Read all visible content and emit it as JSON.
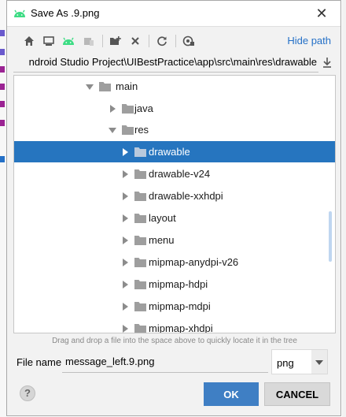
{
  "window": {
    "title": "Save As .9.png",
    "close_glyph": "✕"
  },
  "toolbar": {
    "buttons": [
      {
        "name": "home-icon"
      },
      {
        "name": "desktop-icon"
      },
      {
        "name": "android-icon"
      },
      {
        "name": "module-icon"
      },
      {
        "name": "new-folder-icon"
      },
      {
        "name": "delete-icon"
      },
      {
        "name": "refresh-icon"
      },
      {
        "name": "show-hidden-icon"
      }
    ],
    "hide_path_label": "Hide path"
  },
  "path": {
    "value": "ndroid Studio Project\\UIBestPractice\\app\\src\\main\\res\\drawable"
  },
  "tree": {
    "rows": [
      {
        "label": "main",
        "expanded": true,
        "selected": false
      },
      {
        "label": "java",
        "expanded": false,
        "selected": false
      },
      {
        "label": "res",
        "expanded": true,
        "selected": false
      },
      {
        "label": "drawable",
        "expanded": false,
        "selected": true
      },
      {
        "label": "drawable-v24",
        "expanded": false,
        "selected": false
      },
      {
        "label": "drawable-xxhdpi",
        "expanded": false,
        "selected": false
      },
      {
        "label": "layout",
        "expanded": false,
        "selected": false
      },
      {
        "label": "menu",
        "expanded": false,
        "selected": false
      },
      {
        "label": "mipmap-anydpi-v26",
        "expanded": false,
        "selected": false
      },
      {
        "label": "mipmap-hdpi",
        "expanded": false,
        "selected": false
      },
      {
        "label": "mipmap-mdpi",
        "expanded": false,
        "selected": false
      },
      {
        "label": "mipmap-xhdpi",
        "expanded": false,
        "selected": false
      }
    ]
  },
  "hint": "Drag and drop a file into the space above to quickly locate it in the tree",
  "file_name": {
    "label": "File name:",
    "value": "message_left.9.png"
  },
  "file_type": {
    "value": "png"
  },
  "buttons": {
    "help": "?",
    "ok": "OK",
    "cancel": "CANCEL"
  },
  "colors": {
    "selection": "#2675bf",
    "link": "#2470c7",
    "primary_button": "#3f7fc4",
    "android_green": "#3ddc84"
  }
}
